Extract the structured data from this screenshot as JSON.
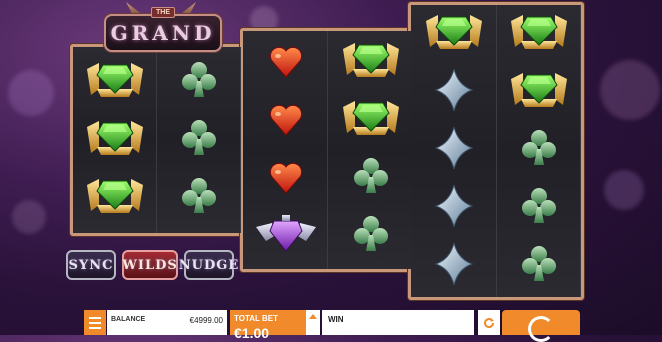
{
  "game": {
    "logo_small": "THE",
    "logo_main": "GRAND"
  },
  "reels": [
    [
      "emerald-badge",
      "emerald-badge",
      "emerald-badge"
    ],
    [
      "club",
      "club",
      "club"
    ],
    [
      "heart",
      "heart",
      "heart",
      "amethyst-badge"
    ],
    [
      "emerald-badge",
      "emerald-badge",
      "club",
      "club"
    ],
    [
      "emerald-badge",
      "diamond",
      "diamond",
      "diamond",
      "diamond"
    ],
    [
      "emerald-badge",
      "emerald-badge",
      "club",
      "club",
      "club"
    ]
  ],
  "features": {
    "sync": "SYNC",
    "wilds": "WILDS",
    "nudge": "NUDGE"
  },
  "controls": {
    "balance_label": "BALANCE",
    "balance_value": "€4999.00",
    "total_bet_label": "TOTAL BET",
    "total_bet_value": "€1.00",
    "win_label": "WIN"
  },
  "colors": {
    "accent": "#f08a2a",
    "frame": "#c9977a",
    "background": "#3f1d52"
  }
}
